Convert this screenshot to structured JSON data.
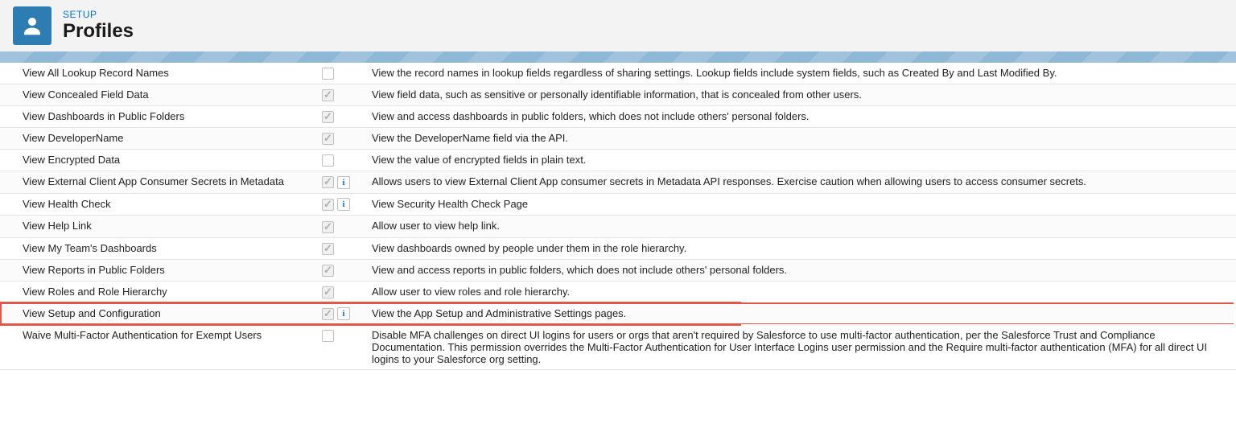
{
  "header": {
    "setup_label": "SETUP",
    "title": "Profiles"
  },
  "rows": [
    {
      "name": "View All Lookup Record Names",
      "checked": false,
      "info": false,
      "desc": "View the record names in lookup fields regardless of sharing settings. Lookup fields include system fields, such as Created By and Last Modified By."
    },
    {
      "name": "View Concealed Field Data",
      "checked": true,
      "info": false,
      "desc": "View field data, such as sensitive or personally identifiable information, that is concealed from other users."
    },
    {
      "name": "View Dashboards in Public Folders",
      "checked": true,
      "info": false,
      "desc": "View and access dashboards in public folders, which does not include others' personal folders."
    },
    {
      "name": "View DeveloperName",
      "checked": true,
      "info": false,
      "desc": "View the DeveloperName field via the API."
    },
    {
      "name": "View Encrypted Data",
      "checked": false,
      "info": false,
      "desc": "View the value of encrypted fields in plain text."
    },
    {
      "name": "View External Client App Consumer Secrets in Metadata",
      "checked": true,
      "info": true,
      "desc": "Allows users to view External Client App consumer secrets in Metadata API responses. Exercise caution when allowing users to access consumer secrets."
    },
    {
      "name": "View Health Check",
      "checked": true,
      "info": true,
      "desc": "View Security Health Check Page"
    },
    {
      "name": "View Help Link",
      "checked": true,
      "info": false,
      "desc": "Allow user to view help link."
    },
    {
      "name": "View My Team's Dashboards",
      "checked": true,
      "info": false,
      "desc": "View dashboards owned by people under them in the role hierarchy."
    },
    {
      "name": "View Reports in Public Folders",
      "checked": true,
      "info": false,
      "desc": "View and access reports in public folders, which does not include others' personal folders."
    },
    {
      "name": "View Roles and Role Hierarchy",
      "checked": true,
      "info": false,
      "desc": "Allow user to view roles and role hierarchy."
    },
    {
      "name": "View Setup and Configuration",
      "checked": true,
      "info": true,
      "desc": "View the App Setup and Administrative Settings pages.",
      "highlight": true
    },
    {
      "name": "Waive Multi-Factor Authentication for Exempt Users",
      "checked": false,
      "info": false,
      "desc": "Disable MFA challenges on direct UI logins for users or orgs that aren't required by Salesforce to use multi-factor authentication, per the Salesforce Trust and Compliance Documentation. This permission overrides the Multi-Factor Authentication for User Interface Logins user permission and the Require multi-factor authentication (MFA) for all direct UI logins to your Salesforce org setting."
    }
  ]
}
